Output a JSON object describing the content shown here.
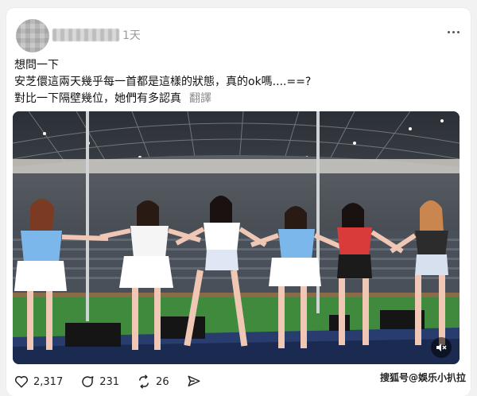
{
  "post": {
    "time": "1天",
    "lines": [
      "想問一下",
      "安芝儇這兩天幾乎每一首都是這樣的狀態，真的ok嗎....==?",
      "對比一下隔壁幾位，她們有多認真"
    ],
    "translate_label": "翻譯"
  },
  "actions": {
    "likes": "2,317",
    "comments": "231",
    "reposts": "26"
  },
  "icons": {
    "more": "more-dots-icon",
    "like": "heart-icon",
    "comment": "comment-icon",
    "repost": "repost-icon",
    "share": "send-icon",
    "mute": "volume-mute-icon"
  },
  "watermark": "搜狐号@娛乐小扒拉"
}
